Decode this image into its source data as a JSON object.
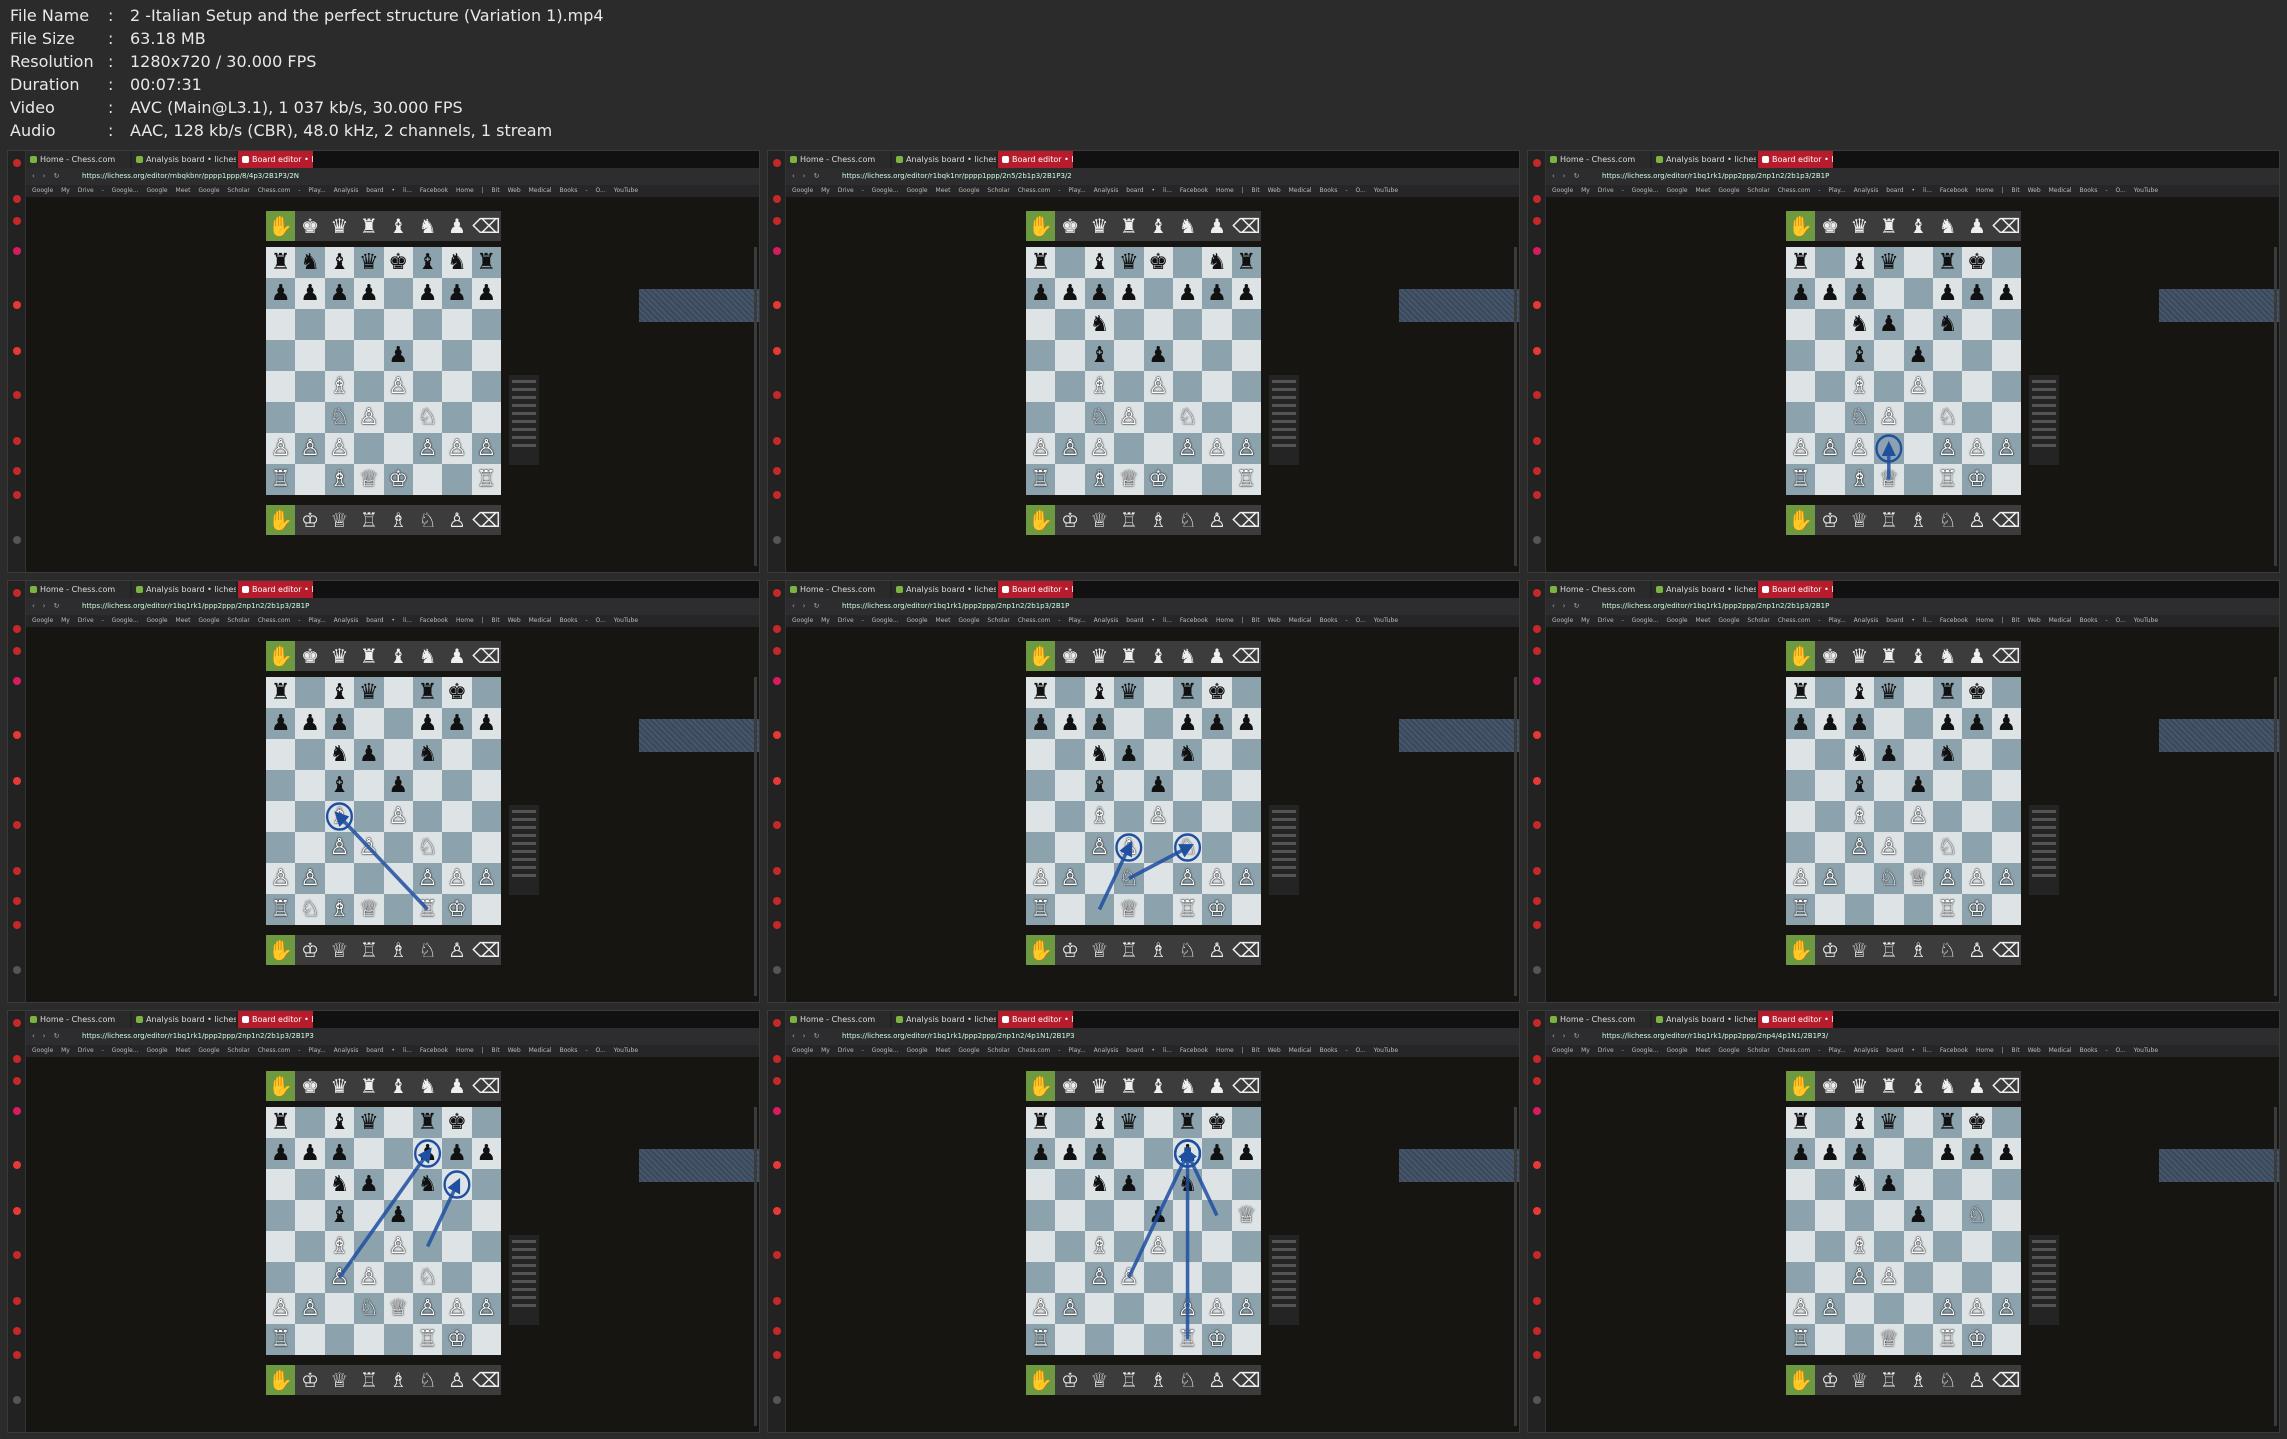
{
  "file_info": [
    {
      "key": "File Name",
      "value": "2 -Italian Setup and the perfect structure (Variation 1).mp4"
    },
    {
      "key": "File Size",
      "value": "63.18 MB"
    },
    {
      "key": "Resolution",
      "value": "1280x720 / 30.000 FPS"
    },
    {
      "key": "Duration",
      "value": "00:07:31"
    },
    {
      "key": "Video",
      "value": "AVC (Main@L3.1), 1 037 kb/s, 30.000 FPS"
    },
    {
      "key": "Audio",
      "value": "AAC, 128 kb/s (CBR), 48.0 kHz, 2 channels, 1 stream"
    }
  ],
  "browser": {
    "tabs": [
      "Home - Chess.com",
      "Analysis board • lichess.o",
      "Board editor • li"
    ],
    "active_tab": 2,
    "bookmarks": "Google  My Drive - Google...  Google Meet  Google Scholar  Chess.com - Play...  Analysis board • li...  Facebook  Home | Bit Web  Medical Books - O...  YouTube"
  },
  "thumbnails": [
    {
      "url": "https://lichess.org/editor/rnbqkbnr/pppp1ppp/8/4p3/2B1P3/2N",
      "board": [
        "rnbqkbnr",
        "pppp1ppp",
        "8",
        "4p3",
        "2B1P3",
        "2NP1N2",
        "PPP2PPP",
        "R1BQK2R"
      ],
      "arrows": []
    },
    {
      "url": "https://lichess.org/editor/r1bqk1nr/pppp1ppp/2n5/2b1p3/2B1P3/2",
      "board": [
        "r1bqk1nr",
        "pppp1ppp",
        "2n5",
        "2b1p3",
        "2B1P3",
        "2NP1N2",
        "PPP2PPP",
        "R1BQK2R"
      ],
      "arrows": []
    },
    {
      "url": "https://lichess.org/editor/r1bq1rk1/ppp2ppp/2np1n2/2b1p3/2B1P",
      "board": [
        "r1bq1rk1",
        "ppp2ppp",
        "2np1n2",
        "2b1p3",
        "2B1P3",
        "2NP1N2",
        "PPP2PPP",
        "R1BQ1RK1"
      ],
      "arrows": [
        [
          [
            3.5,
            7.5
          ],
          [
            3.5,
            6.5
          ]
        ]
      ]
    },
    {
      "url": "https://lichess.org/editor/r1bq1rk1/ppp2ppp/2np1n2/2b1p3/2B1P",
      "board": [
        "r1bq1rk1",
        "ppp2ppp",
        "2np1n2",
        "2b1p3",
        "2B1P3",
        "2PP1N2",
        "PP3PPP",
        "RNBQ1RK1"
      ],
      "arrows": [
        [
          [
            5.5,
            7.5
          ],
          [
            2.5,
            4.5
          ]
        ]
      ]
    },
    {
      "url": "https://lichess.org/editor/r1bq1rk1/ppp2ppp/2np1n2/2b1p3/2B1P",
      "board": [
        "r1bq1rk1",
        "ppp2ppp",
        "2np1n2",
        "2b1p3",
        "2B1P3",
        "2PP1N2",
        "PP1N1PPP",
        "R2Q1RK1"
      ],
      "arrows": [
        [
          [
            2.5,
            7.5
          ],
          [
            3.5,
            5.5
          ]
        ],
        [
          [
            3.5,
            6.5
          ],
          [
            5.5,
            5.5
          ]
        ]
      ]
    },
    {
      "url": "https://lichess.org/editor/r1bq1rk1/ppp2ppp/2np1n2/2b1p3/2B1P",
      "board": [
        "r1bq1rk1",
        "ppp2ppp",
        "2np1n2",
        "2b1p3",
        "2B1P3",
        "2PP1N2",
        "PP1NQPPP",
        "R4RK1"
      ],
      "arrows": []
    },
    {
      "url": "https://lichess.org/editor/r1bq1rk1/ppp2ppp/2np1n2/2b1p3/2B1P3",
      "board": [
        "r1bq1rk1",
        "ppp2ppp",
        "2np1n2",
        "2b1p3",
        "2B1P3",
        "2PP1N2",
        "PP1NQPPP",
        "R4RK1"
      ],
      "arrows": [
        [
          [
            2.5,
            5.5
          ],
          [
            5.5,
            1.5
          ]
        ],
        [
          [
            5.5,
            4.5
          ],
          [
            6.5,
            2.5
          ]
        ]
      ]
    },
    {
      "url": "https://lichess.org/editor/r1bq1rk1/ppp2ppp/2np1n2/4p1N1/2B1P3",
      "board": [
        "r1bq1rk1",
        "ppp2ppp",
        "2np1n2",
        "4p2Q",
        "2B1P3",
        "2PP4",
        "PP3PPP",
        "R4RK1"
      ],
      "arrows": [
        [
          [
            3.5,
            5.5
          ],
          [
            5.5,
            1.5
          ]
        ],
        [
          [
            5.5,
            7.5
          ],
          [
            5.5,
            1.5
          ]
        ],
        [
          [
            6.5,
            3.5
          ],
          [
            5.5,
            1.5
          ]
        ]
      ]
    },
    {
      "url": "https://lichess.org/editor/r1bq1rk1/ppp2ppp/2np4/4p1N1/2B1P3/",
      "board": [
        "r1bq1rk1",
        "ppp2ppp",
        "2np4",
        "4p1N1",
        "2B1P3",
        "2PP4",
        "PP3PPP",
        "R2Q1RK1"
      ],
      "arrows": []
    }
  ]
}
